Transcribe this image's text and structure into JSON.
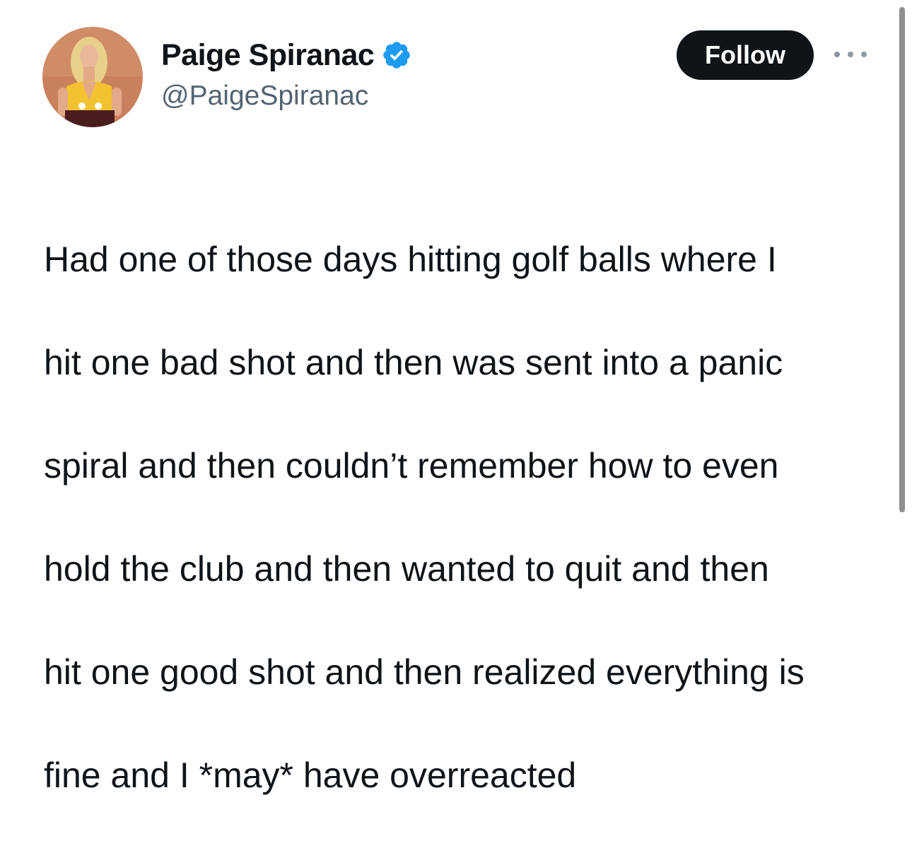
{
  "author": {
    "display_name": "Paige Spiranac",
    "handle": "@PaigeSpiranac",
    "verified": true,
    "avatar_icon": "profile-photo"
  },
  "actions": {
    "follow_label": "Follow",
    "more_icon": "more-horizontal-icon"
  },
  "tweet": {
    "text_lines": [
      "Had one of those days hitting golf balls where I",
      "hit one bad shot and then was sent into a panic",
      "spiral and then couldn’t remember how to even",
      "hold the club and then wanted to quit and then",
      "hit one good shot and then realized everything is",
      "fine and I *may* have overreacted"
    ]
  },
  "colors": {
    "text_primary": "#0f1419",
    "text_secondary": "#536471",
    "verified_blue": "#1d9bf0",
    "button_bg": "#0f1419",
    "button_text": "#ffffff"
  }
}
